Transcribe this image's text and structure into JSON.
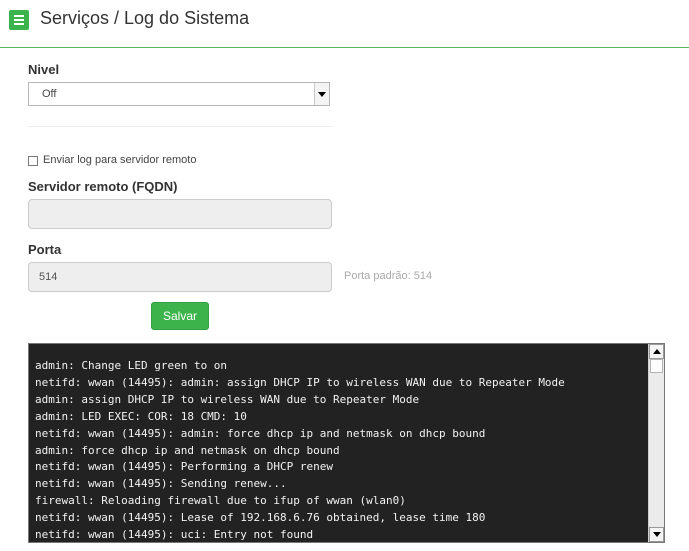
{
  "header": {
    "menu_icon": "hamburger-menu-icon",
    "title": "Serviços / Log do Sistema",
    "accent_color": "#3cb44b"
  },
  "form": {
    "level_label": "Nivel",
    "level_value": "Off",
    "remote_checkbox_label": "Enviar log para servidor remoto",
    "remote_checkbox_checked": false,
    "server_label": "Servidor remoto (FQDN)",
    "server_value": "",
    "port_label": "Porta",
    "port_value": "514",
    "port_hint": "Porta padrão: 514",
    "save_label": "Salvar"
  },
  "log": {
    "lines": [
      "admin: Change LED green to on",
      "netifd: wwan (14495): admin: assign DHCP IP to wireless WAN due to Repeater Mode",
      "admin: assign DHCP IP to wireless WAN due to Repeater Mode",
      "admin: LED EXEC: COR: 18 CMD: 10",
      "netifd: wwan (14495): admin: force dhcp ip and netmask on dhcp bound",
      "admin: force dhcp ip and netmask on dhcp bound",
      "netifd: wwan (14495): Performing a DHCP renew",
      "netifd: wwan (14495): Sending renew...",
      "firewall: Reloading firewall due to ifup of wwan (wlan0)",
      "netifd: wwan (14495): Lease of 192.168.6.76 obtained, lease time 180",
      "netifd: wwan (14495): uci: Entry not found"
    ],
    "background_color": "#222222"
  }
}
